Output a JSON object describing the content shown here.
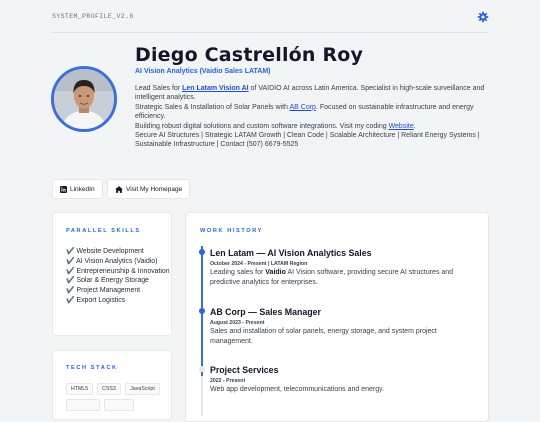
{
  "header": {
    "system_label": "SYSTEM_PROFILE_V2.6",
    "settings_icon": "gear-icon",
    "accent": "#2563eb"
  },
  "profile": {
    "name": "Diego Castrellón Roy",
    "role": "AI Vision Analytics (Vaidio Sales LATAM)",
    "bio": {
      "l1_before": "Lead Sales for ",
      "l1_link": "Len Latam Vision AI",
      "l1_after": " of VAIDIO AI across Latin America. Specialist in high-scale surveillance and intelligent analytics.",
      "l2_before": "Strategic Sales & Installation of Solar Panels with ",
      "l2_link": "AB Corp",
      "l2_after": ". Focused on sustainable infrastructure and energy efficiency.",
      "l3_before": "Building robust digital solutions and custom software integrations. Visit my coding ",
      "l3_link": "Website",
      "l3_after": ".",
      "l4": "Secure AI Structures | Strategic LATAM Growth | Clean Code | Scalable Architecture | Reliant Energy Systems | Sustainable Infrastructure | Contact (507) 6679-5525"
    }
  },
  "buttons": {
    "linkedin": "LinkedIn",
    "homepage": "Visit My Homepage"
  },
  "skills": {
    "title": "PARALLEL SKILLS",
    "items": [
      "✔️ Website Development",
      "✔️ AI Vision Analytics (Vaidio)",
      "✔️ Entrepreneurship & Innovation",
      "✔️ Solar & Energy Storage",
      "✔️ Project Management",
      "✔️ Export Logistics"
    ]
  },
  "tech": {
    "title": "TECH STACK",
    "tags": [
      "HTML5",
      "CSS3",
      "JavaScript"
    ]
  },
  "work": {
    "title": "WORK HISTORY",
    "jobs": [
      {
        "title": "Len Latam — AI Vision Analytics Sales",
        "meta": "October 2024 - Present | LATAM Region",
        "desc_before": "Leading sales for ",
        "desc_bold": "Vaidio",
        "desc_after": " AI Vision software, providing secure AI structures and predictive analytics for enterprises."
      },
      {
        "title": "AB Corp — Sales Manager",
        "meta": "August 2023 - Present",
        "desc": "Sales and installation of solar panels, energy storage, and system project management."
      },
      {
        "title": "Project Services",
        "meta": "2022 - Present",
        "desc": "Web app development, telecommunications and energy."
      }
    ]
  }
}
